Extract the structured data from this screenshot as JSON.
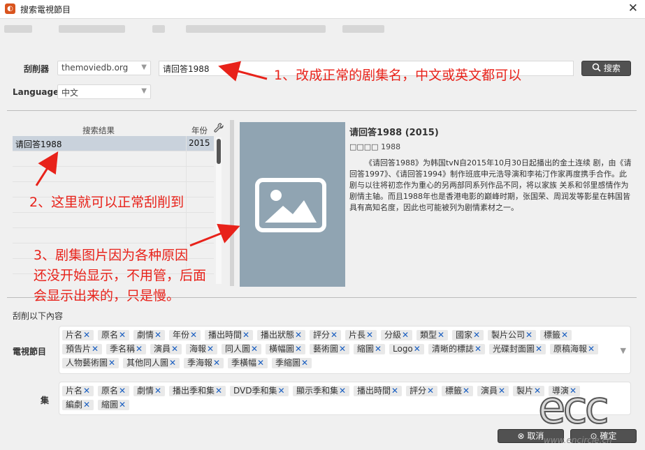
{
  "window": {
    "title": "搜索電視節目"
  },
  "form": {
    "scraper_label": "刮削器",
    "scraper_value": "themoviedb.org",
    "query_value": "请回答1988",
    "search_label": "搜索",
    "language_label": "Language",
    "language_value": "中文"
  },
  "results": {
    "col_title": "搜索结果",
    "col_year": "年份",
    "rows": [
      {
        "title": "请回答1988",
        "year": "2015"
      }
    ]
  },
  "detail": {
    "title": "请回答1988 (2015)",
    "meta": "□□□□ 1988",
    "description": "《请回答1988》为韩国tvN自2015年10月30日起播出的金土连续 剧，由《请回答1997》、《请回答1994》制作班底申元浩导演和李祐汀作家再度携手合作。此剧与以往将初恋作为重心的另两部同系列作品不同，将以家族 关系和邻里感情作为剧情主轴。而且1988年也是香港电影的巅峰时期，张国荣、周润发等影星在韩国皆具有高知名度，因此也可能被列为剧情素材之一。"
  },
  "scrape_section": {
    "title": "刮削以下內容",
    "tv_label": "電視節目",
    "tv_tags": [
      "片名",
      "原名",
      "劇情",
      "年份",
      "播出時間",
      "播出狀態",
      "評分",
      "片長",
      "分級",
      "類型",
      "國家",
      "製片公司",
      "標籤",
      "預告片",
      "季名稱",
      "演員",
      "海報",
      "同人圖",
      "橫幅圖",
      "藝術圖",
      "縮圖",
      "Logo",
      "清晰的標誌",
      "光碟封面圖",
      "原稿海報",
      "人物藝術圖",
      "其他同人圖",
      "季海報",
      "季橫幅",
      "季縮圖"
    ],
    "ep_label": "集",
    "ep_tags": [
      "片名",
      "原名",
      "劇情",
      "播出季和集",
      "DVD季和集",
      "顯示季和集",
      "播出時間",
      "評分",
      "標籤",
      "演員",
      "製片",
      "導演",
      "編劇",
      "縮圖"
    ]
  },
  "buttons": {
    "cancel": "取消",
    "ok": "確定"
  },
  "annotations": {
    "a1": "1、改成正常的剧集名，中文或英文都可以",
    "a2": "2、这里就可以正常刮削到",
    "a3_l1": "3、剧集图片因为各种原因",
    "a3_l2": "还没开始显示，不用管，后面",
    "a3_l3": "会显示出来的，只是慢。"
  },
  "watermark": {
    "logo": "ecc",
    "site": "www.encircle.cn"
  },
  "colors": {
    "annotation": "#e8221a",
    "tag_remove": "#1a5fc1",
    "poster_bg": "#90a4b2",
    "button_bg": "#515151"
  },
  "icons": {
    "search": "search-icon",
    "close": "close-icon",
    "wrench": "wrench-icon",
    "image": "image-placeholder-icon"
  }
}
